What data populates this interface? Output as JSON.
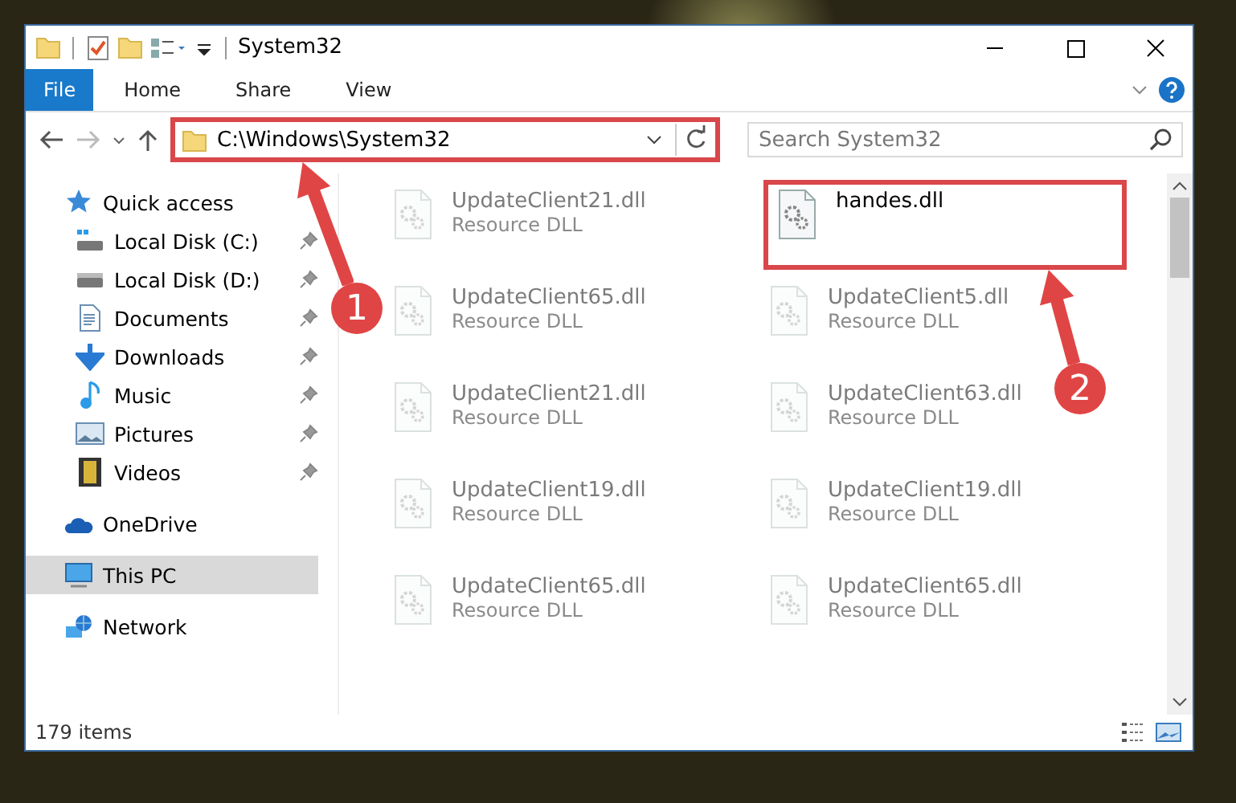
{
  "window": {
    "title": "System32"
  },
  "ribbon_tabs": [
    {
      "label": "File",
      "selected": true
    },
    {
      "label": "Home",
      "selected": false
    },
    {
      "label": "Share",
      "selected": false
    },
    {
      "label": "View",
      "selected": false
    }
  ],
  "address_bar": {
    "path": "C:\\Windows\\System32",
    "highlighted": true
  },
  "search": {
    "placeholder": "Search System32"
  },
  "sidebar": {
    "items": [
      {
        "label": "Quick access",
        "kind": "star",
        "selected": false,
        "children": [
          {
            "label": "Local Disk (C:)",
            "kind": "system-drive",
            "pinned": true,
            "selected": false
          },
          {
            "label": "Local Disk (D:)",
            "kind": "drive",
            "pinned": true,
            "selected": false
          },
          {
            "label": "Documents",
            "kind": "document",
            "pinned": true,
            "selected": false
          },
          {
            "label": "Downloads",
            "kind": "download",
            "pinned": true,
            "selected": false
          },
          {
            "label": "Music",
            "kind": "music",
            "pinned": true,
            "selected": false
          },
          {
            "label": "Pictures",
            "kind": "picture",
            "pinned": true,
            "selected": false
          },
          {
            "label": "Videos",
            "kind": "video",
            "pinned": true,
            "selected": false
          }
        ]
      },
      {
        "label": "OneDrive",
        "kind": "cloud",
        "selected": false
      },
      {
        "label": "This PC",
        "kind": "computer",
        "selected": true
      },
      {
        "label": "Network",
        "kind": "network",
        "selected": false
      }
    ]
  },
  "files": [
    {
      "name": "UpdateClient21.dll",
      "type": "Resource DLL",
      "faded": true,
      "highlighted": false
    },
    {
      "name": "handes.dll",
      "faded": false,
      "highlighted": true
    },
    {
      "name": "UpdateClient65.dll",
      "type": "Resource DLL",
      "faded": true,
      "highlighted": false
    },
    {
      "name": "UpdateClient5.dll",
      "type": "Resource DLL",
      "faded": true,
      "highlighted": false
    },
    {
      "name": "UpdateClient21.dll",
      "type": "Resource DLL",
      "faded": true,
      "highlighted": false
    },
    {
      "name": "UpdateClient63.dll",
      "type": "Resource DLL",
      "faded": true,
      "highlighted": false
    },
    {
      "name": "UpdateClient19.dll",
      "type": "Resource DLL",
      "faded": true,
      "highlighted": false
    },
    {
      "name": "UpdateClient19.dll",
      "type": "Resource DLL",
      "faded": true,
      "highlighted": false
    },
    {
      "name": "UpdateClient65.dll",
      "type": "Resource DLL",
      "faded": true,
      "highlighted": false
    },
    {
      "name": "UpdateClient65.dll",
      "type": "Resource DLL",
      "faded": true,
      "highlighted": false
    }
  ],
  "status_bar": {
    "item_count": "179 items"
  },
  "annotations": [
    {
      "label": "1"
    },
    {
      "label": "2"
    }
  ]
}
